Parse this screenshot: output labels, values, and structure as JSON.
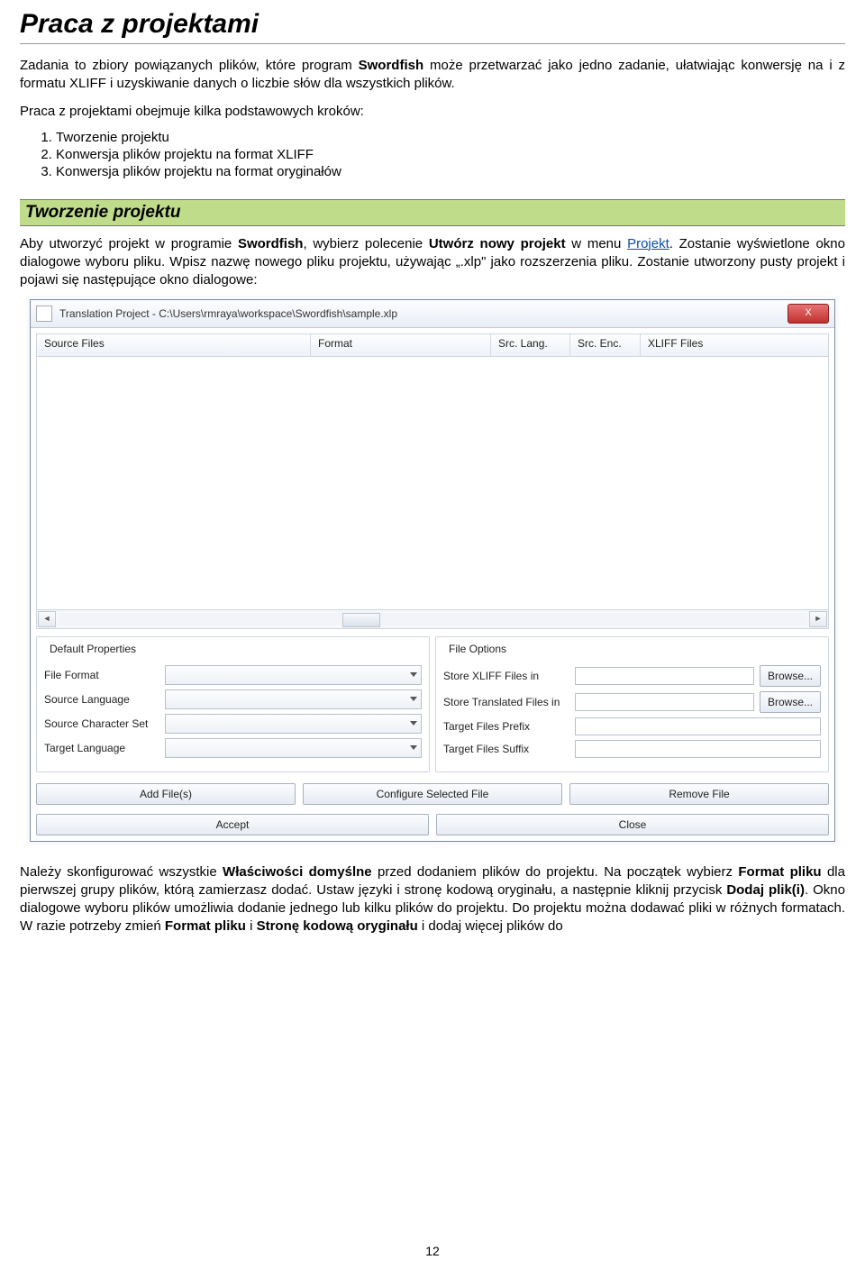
{
  "title": "Praca z projektami",
  "intro_1a": "Zadania to zbiory powiązanych plików, które program ",
  "intro_1b": "Swordfish",
  "intro_1c": " może przetwarzać jako jedno zadanie, ułatwiając konwersję na i z formatu XLIFF i uzyskiwanie danych o liczbie słów dla wszystkich plików.",
  "intro_2": "Praca z projektami obejmuje kilka podstawowych kroków:",
  "steps": {
    "0": "Tworzenie projektu",
    "1": "Konwersja plików projektu na format XLIFF",
    "2": "Konwersja plików projektu na format oryginałów"
  },
  "sub_heading": "Tworzenie projektu",
  "sec_1a": "Aby utworzyć projekt w programie ",
  "sec_1b": "Swordfish",
  "sec_1c": ", wybierz polecenie ",
  "sec_1d": "Utwórz nowy projekt",
  "sec_1e": " w menu ",
  "sec_link": "Projekt",
  "sec_1f": ". Zostanie wyświetlone okno dialogowe wyboru pliku. Wpisz nazwę nowego pliku projektu, używając „.xlp\" jako rozszerzenia pliku. Zostanie utworzony pusty projekt i pojawi się następujące okno dialogowe:",
  "dialog": {
    "title": "Translation Project - C:\\Users\\rmraya\\workspace\\Swordfish\\sample.xlp",
    "close_x": "X",
    "columns": {
      "0": "Source Files",
      "1": "Format",
      "2": "Src. Lang.",
      "3": "Src. Enc.",
      "4": "XLIFF Files"
    },
    "panel_left_title": "Default Properties",
    "panel_right_title": "File Options",
    "left_labels": {
      "0": "File Format",
      "1": "Source Language",
      "2": "Source Character Set",
      "3": "Target Language"
    },
    "right_labels": {
      "0": "Store XLIFF Files in",
      "1": "Store Translated Files in",
      "2": "Target Files Prefix",
      "3": "Target Files Suffix"
    },
    "browse": "Browse...",
    "buttons_row1": {
      "0": "Add File(s)",
      "1": "Configure Selected File",
      "2": "Remove File"
    },
    "buttons_row2": {
      "0": "Accept",
      "1": "Close"
    }
  },
  "after_1a": "Należy skonfigurować wszystkie ",
  "after_1b": "Właściwości domyślne",
  "after_1c": " przed dodaniem plików do projektu. Na początek wybierz ",
  "after_1d": "Format pliku",
  "after_1e": " dla pierwszej grupy plików, którą zamierzasz dodać. Ustaw języki i stronę kodową oryginału, a następnie kliknij przycisk ",
  "after_1f": "Dodaj plik(i)",
  "after_1g": ". Okno dialogowe wyboru plików umożliwia dodanie jednego lub kilku plików do projektu. Do projektu można dodawać pliki w różnych formatach. W razie potrzeby zmień ",
  "after_1h": "Format pliku",
  "after_1i": " i ",
  "after_1j": "Stronę kodową oryginału",
  "after_1k": " i dodaj więcej plików do",
  "page_number": "12"
}
